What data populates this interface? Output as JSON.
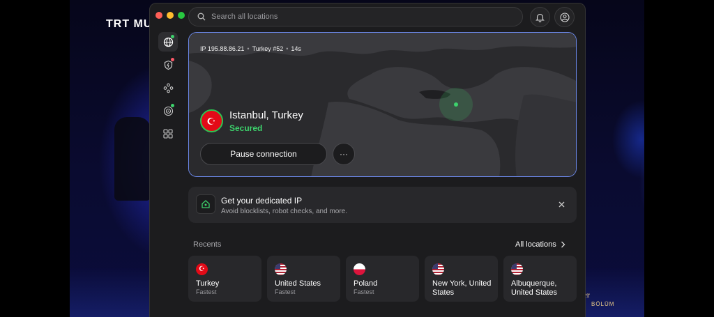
{
  "background": {
    "channel_logo": "TRT MU",
    "caption": "rgiler",
    "caption_sub": "BÖLÜM"
  },
  "header": {
    "search_placeholder": "Search all locations"
  },
  "connection": {
    "ip_label": "IP 195.88.86.21",
    "server": "Turkey #52",
    "duration": "14s",
    "location": "Istanbul, Turkey",
    "status": "Secured",
    "pause_label": "Pause connection",
    "more_label": "···"
  },
  "promo": {
    "title": "Get your dedicated IP",
    "subtitle": "Avoid blocklists, robot checks, and more."
  },
  "recents": {
    "label": "Recents",
    "all_locations": "All locations",
    "items": [
      {
        "name": "Turkey",
        "sub": "Fastest",
        "flag": "turkey-flag"
      },
      {
        "name": "United States",
        "sub": "Fastest",
        "flag": "us-flag"
      },
      {
        "name": "Poland",
        "sub": "Fastest",
        "flag": "poland-flag"
      },
      {
        "name": "New York, United States",
        "sub": "",
        "flag": "us-flag"
      },
      {
        "name": "Albuquerque, United States",
        "sub": "",
        "flag": "us-flag"
      }
    ]
  },
  "colors": {
    "accent_border": "#6b87e8",
    "secured_green": "#3dd26c",
    "window_bg": "#1c1c1e"
  }
}
